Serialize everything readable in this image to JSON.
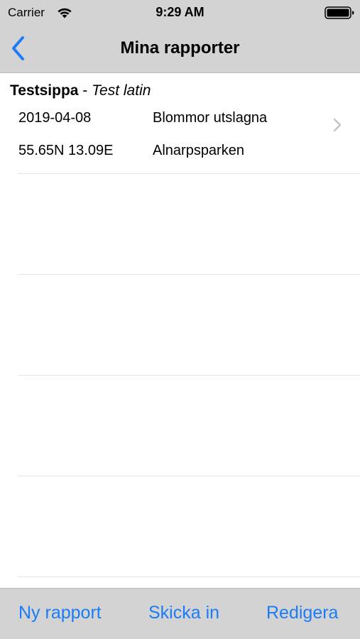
{
  "status_bar": {
    "carrier": "Carrier",
    "time": "9:29 AM",
    "wifi_icon": "wifi-icon",
    "battery_icon": "battery-icon"
  },
  "nav_bar": {
    "title": "Mina rapporter",
    "back_icon": "chevron-left-icon"
  },
  "section": {
    "species": "Testsippa",
    "separator": " - ",
    "latin_name": "Test latin"
  },
  "reports": [
    {
      "date": "2019-04-08",
      "status": "Blommor utslagna",
      "coordinates": "55.65N 13.09E",
      "location": "Alnarpsparken"
    }
  ],
  "toolbar": {
    "new_report": "Ny rapport",
    "send": "Skicka in",
    "edit": "Redigera"
  },
  "colors": {
    "accent": "#1a7cf6",
    "bar_background": "#d3d3d3",
    "separator": "#e6e6e6"
  }
}
